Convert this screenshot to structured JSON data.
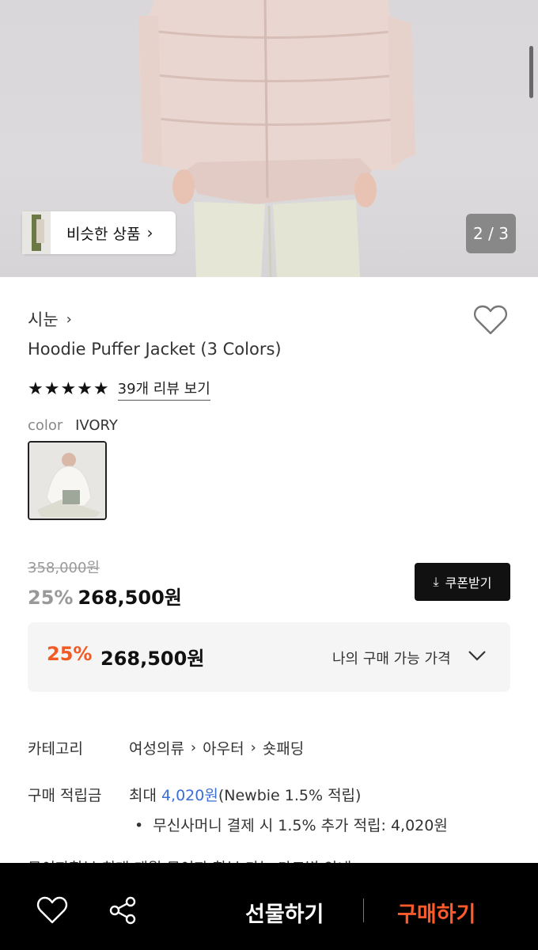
{
  "hero": {
    "similar_label": "비슷한 상품",
    "pager": "2 / 3"
  },
  "product": {
    "brand": "시눈",
    "title": "Hoodie Puffer Jacket (3 Colors)",
    "rating_stars": "★★★★★",
    "review_link": "39개 리뷰 보기",
    "color_key": "color",
    "color_value": "IVORY"
  },
  "price": {
    "original": "358,000원",
    "discount": "25%",
    "sale": "268,500원",
    "coupon_label": "쿠폰받기",
    "my_discount": "25%",
    "my_price": "268,500원",
    "my_price_label": "나의 구매 가능 가격"
  },
  "info": {
    "category_key": "카테고리",
    "category_path": [
      "여성의류",
      "아우터",
      "숏패딩"
    ],
    "points_key": "구매 적립금",
    "points_prefix": "최대",
    "points_value": "4,020원",
    "points_suffix": "(Newbie 1.5% 적립)",
    "points_bullet": "무신사머니 결제 시 1.5% 추가 적립: 4,020원",
    "cut_text": "무이자할부   최대 개월 무이자 할부 가능     카드별 안내"
  },
  "bottom": {
    "gift_label": "선물하기",
    "buy_label": "구매하기"
  },
  "colors": {
    "accent": "#f15a24",
    "buy": "#ff5a2a",
    "link": "#3b6fd6",
    "bar": "#000000"
  }
}
